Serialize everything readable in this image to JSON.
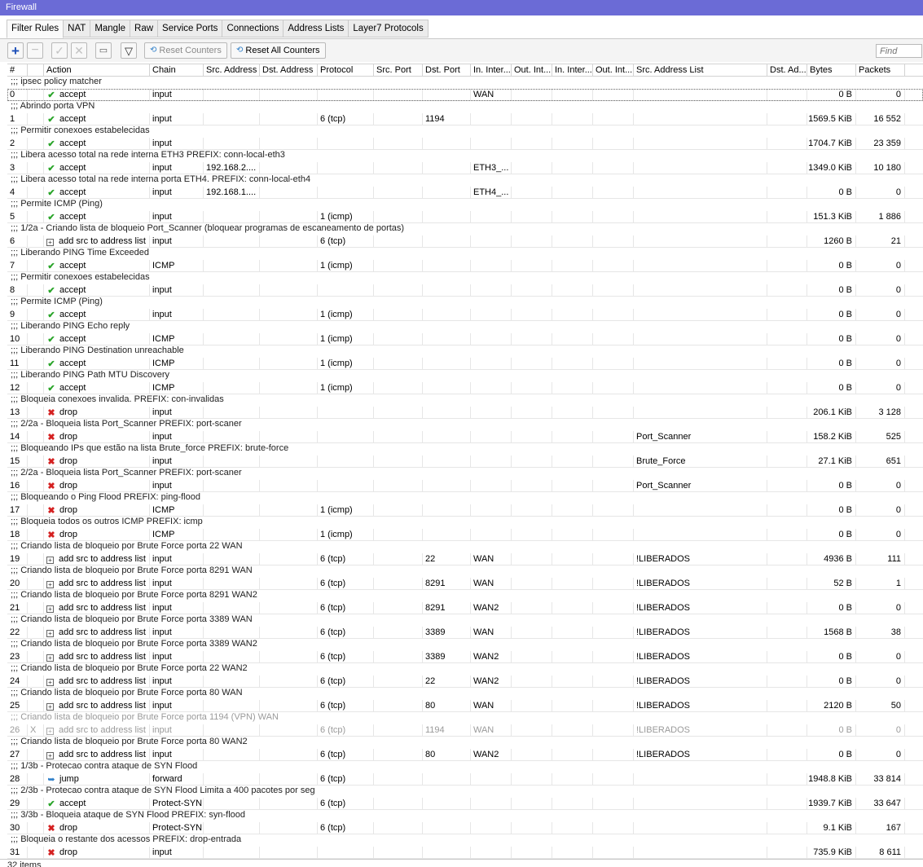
{
  "window": {
    "title": "Firewall"
  },
  "tabs": [
    "Filter Rules",
    "NAT",
    "Mangle",
    "Raw",
    "Service Ports",
    "Connections",
    "Address Lists",
    "Layer7 Protocols"
  ],
  "toolbar": {
    "reset_counters": "Reset Counters",
    "reset_all_counters": "Reset All Counters",
    "find_placeholder": "Find"
  },
  "columns": [
    "#",
    "",
    "Action",
    "Chain",
    "Src. Address",
    "Dst. Address",
    "Protocol",
    "Src. Port",
    "Dst. Port",
    "In. Inter...",
    "Out. Int...",
    "In. Inter...",
    "Out. Int...",
    "Src. Address List",
    "Dst. Ad...",
    "Bytes",
    "Packets"
  ],
  "rules": [
    {
      "comment": ";;; ipsec policy matcher",
      "num": "0",
      "action": "accept",
      "chain": "input",
      "src": "",
      "proto": "",
      "dport": "",
      "in": "WAN",
      "srclist": "",
      "bytes": "0 B",
      "packets": "0"
    },
    {
      "comment": ";;; Abrindo porta VPN",
      "num": "1",
      "action": "accept",
      "chain": "input",
      "src": "",
      "proto": "6 (tcp)",
      "dport": "1194",
      "in": "",
      "srclist": "",
      "bytes": "1569.5 KiB",
      "packets": "16 552"
    },
    {
      "comment": ";;; Permitir conexoes estabelecidas",
      "num": "2",
      "action": "accept",
      "chain": "input",
      "src": "",
      "proto": "",
      "dport": "",
      "in": "",
      "srclist": "",
      "bytes": "1704.7 KiB",
      "packets": "23 359"
    },
    {
      "comment": ";;; Libera acesso total na rede interna ETH3 PREFIX: conn-local-eth3",
      "num": "3",
      "action": "accept",
      "chain": "input",
      "src": "192.168.2....",
      "proto": "",
      "dport": "",
      "in": "ETH3_...",
      "srclist": "",
      "bytes": "1349.0 KiB",
      "packets": "10 180"
    },
    {
      "comment": ";;; Libera acesso total na rede interna porta ETH4. PREFIX: conn-local-eth4",
      "num": "4",
      "action": "accept",
      "chain": "input",
      "src": "192.168.1....",
      "proto": "",
      "dport": "",
      "in": "ETH4_...",
      "srclist": "",
      "bytes": "0 B",
      "packets": "0"
    },
    {
      "comment": ";;; Permite ICMP (Ping)",
      "num": "5",
      "action": "accept",
      "chain": "input",
      "src": "",
      "proto": "1 (icmp)",
      "dport": "",
      "in": "",
      "srclist": "",
      "bytes": "151.3 KiB",
      "packets": "1 886"
    },
    {
      "comment": ";;; 1/2a - Criando lista de bloqueio Port_Scanner (bloquear programas de escaneamento de portas)",
      "num": "6",
      "action": "add src to address list",
      "chain": "input",
      "src": "",
      "proto": "6 (tcp)",
      "dport": "",
      "in": "",
      "srclist": "",
      "bytes": "1260 B",
      "packets": "21"
    },
    {
      "comment": ";;; Liberando PING Time Exceeded",
      "num": "7",
      "action": "accept",
      "chain": "ICMP",
      "src": "",
      "proto": "1 (icmp)",
      "dport": "",
      "in": "",
      "srclist": "",
      "bytes": "0 B",
      "packets": "0"
    },
    {
      "comment": ";;; Permitir conexoes estabelecidas",
      "num": "8",
      "action": "accept",
      "chain": "input",
      "src": "",
      "proto": "",
      "dport": "",
      "in": "",
      "srclist": "",
      "bytes": "0 B",
      "packets": "0"
    },
    {
      "comment": ";;; Permite ICMP (Ping)",
      "num": "9",
      "action": "accept",
      "chain": "input",
      "src": "",
      "proto": "1 (icmp)",
      "dport": "",
      "in": "",
      "srclist": "",
      "bytes": "0 B",
      "packets": "0"
    },
    {
      "comment": ";;; Liberando PING Echo reply",
      "num": "10",
      "action": "accept",
      "chain": "ICMP",
      "src": "",
      "proto": "1 (icmp)",
      "dport": "",
      "in": "",
      "srclist": "",
      "bytes": "0 B",
      "packets": "0"
    },
    {
      "comment": ";;; Liberando PING Destination unreachable",
      "num": "11",
      "action": "accept",
      "chain": "ICMP",
      "src": "",
      "proto": "1 (icmp)",
      "dport": "",
      "in": "",
      "srclist": "",
      "bytes": "0 B",
      "packets": "0"
    },
    {
      "comment": ";;; Liberando PING Path MTU Discovery",
      "num": "12",
      "action": "accept",
      "chain": "ICMP",
      "src": "",
      "proto": "1 (icmp)",
      "dport": "",
      "in": "",
      "srclist": "",
      "bytes": "0 B",
      "packets": "0"
    },
    {
      "comment": ";;; Bloqueia conexoes invalida. PREFIX: con-invalidas",
      "num": "13",
      "action": "drop",
      "chain": "input",
      "src": "",
      "proto": "",
      "dport": "",
      "in": "",
      "srclist": "",
      "bytes": "206.1 KiB",
      "packets": "3 128"
    },
    {
      "comment": ";;; 2/2a - Bloqueia lista Port_Scanner PREFIX: port-scaner",
      "num": "14",
      "action": "drop",
      "chain": "input",
      "src": "",
      "proto": "",
      "dport": "",
      "in": "",
      "srclist": "Port_Scanner",
      "bytes": "158.2 KiB",
      "packets": "525"
    },
    {
      "comment": ";;; Bloqueando IPs que estão na lista Brute_force PREFIX: brute-force",
      "num": "15",
      "action": "drop",
      "chain": "input",
      "src": "",
      "proto": "",
      "dport": "",
      "in": "",
      "srclist": "Brute_Force",
      "bytes": "27.1 KiB",
      "packets": "651"
    },
    {
      "comment": ";;; 2/2a - Bloqueia lista Port_Scanner PREFIX: port-scaner",
      "num": "16",
      "action": "drop",
      "chain": "input",
      "src": "",
      "proto": "",
      "dport": "",
      "in": "",
      "srclist": "Port_Scanner",
      "bytes": "0 B",
      "packets": "0"
    },
    {
      "comment": ";;; Bloqueando o Ping Flood PREFIX: ping-flood",
      "num": "17",
      "action": "drop",
      "chain": "ICMP",
      "src": "",
      "proto": "1 (icmp)",
      "dport": "",
      "in": "",
      "srclist": "",
      "bytes": "0 B",
      "packets": "0"
    },
    {
      "comment": ";;; Bloqueia todos os outros ICMP PREFIX: icmp",
      "num": "18",
      "action": "drop",
      "chain": "ICMP",
      "src": "",
      "proto": "1 (icmp)",
      "dport": "",
      "in": "",
      "srclist": "",
      "bytes": "0 B",
      "packets": "0"
    },
    {
      "comment": ";;; Criando lista de bloqueio por Brute Force porta 22 WAN",
      "num": "19",
      "action": "add src to address list",
      "chain": "input",
      "src": "",
      "proto": "6 (tcp)",
      "dport": "22",
      "in": "WAN",
      "srclist": "!LIBERADOS",
      "bytes": "4936 B",
      "packets": "111"
    },
    {
      "comment": ";;; Criando lista de bloqueio por Brute Force porta 8291 WAN",
      "num": "20",
      "action": "add src to address list",
      "chain": "input",
      "src": "",
      "proto": "6 (tcp)",
      "dport": "8291",
      "in": "WAN",
      "srclist": "!LIBERADOS",
      "bytes": "52 B",
      "packets": "1"
    },
    {
      "comment": ";;; Criando lista de bloqueio por Brute Force porta 8291 WAN2",
      "num": "21",
      "action": "add src to address list",
      "chain": "input",
      "src": "",
      "proto": "6 (tcp)",
      "dport": "8291",
      "in": "WAN2",
      "srclist": "!LIBERADOS",
      "bytes": "0 B",
      "packets": "0"
    },
    {
      "comment": ";;; Criando lista de bloqueio por Brute Force porta 3389 WAN",
      "num": "22",
      "action": "add src to address list",
      "chain": "input",
      "src": "",
      "proto": "6 (tcp)",
      "dport": "3389",
      "in": "WAN",
      "srclist": "!LIBERADOS",
      "bytes": "1568 B",
      "packets": "38"
    },
    {
      "comment": ";;; Criando lista de bloqueio por Brute Force porta 3389 WAN2",
      "num": "23",
      "action": "add src to address list",
      "chain": "input",
      "src": "",
      "proto": "6 (tcp)",
      "dport": "3389",
      "in": "WAN2",
      "srclist": "!LIBERADOS",
      "bytes": "0 B",
      "packets": "0"
    },
    {
      "comment": ";;; Criando lista de bloqueio por Brute Force porta 22 WAN2",
      "num": "24",
      "action": "add src to address list",
      "chain": "input",
      "src": "",
      "proto": "6 (tcp)",
      "dport": "22",
      "in": "WAN2",
      "srclist": "!LIBERADOS",
      "bytes": "0 B",
      "packets": "0"
    },
    {
      "comment": ";;; Criando lista de bloqueio por Brute Force porta 80 WAN",
      "num": "25",
      "action": "add src to address list",
      "chain": "input",
      "src": "",
      "proto": "6 (tcp)",
      "dport": "80",
      "in": "WAN",
      "srclist": "!LIBERADOS",
      "bytes": "2120 B",
      "packets": "50"
    },
    {
      "comment": ";;; Criando lista de bloqueio por Brute Force porta 1194 (VPN) WAN",
      "num": "26",
      "flag": "X",
      "disabled": true,
      "action": "add src to address list",
      "chain": "input",
      "src": "",
      "proto": "6 (tcp)",
      "dport": "1194",
      "in": "WAN",
      "srclist": "!LIBERADOS",
      "bytes": "0 B",
      "packets": "0"
    },
    {
      "comment": ";;; Criando lista de bloqueio por Brute Force porta 80 WAN2",
      "num": "27",
      "action": "add src to address list",
      "chain": "input",
      "src": "",
      "proto": "6 (tcp)",
      "dport": "80",
      "in": "WAN2",
      "srclist": "!LIBERADOS",
      "bytes": "0 B",
      "packets": "0"
    },
    {
      "comment": ";;; 1/3b - Protecao contra ataque de SYN Flood",
      "num": "28",
      "action": "jump",
      "chain": "forward",
      "src": "",
      "proto": "6 (tcp)",
      "dport": "",
      "in": "",
      "srclist": "",
      "bytes": "1948.8 KiB",
      "packets": "33 814"
    },
    {
      "comment": ";;; 2/3b - Protecao contra ataque de SYN Flood Limita a 400 pacotes por seg",
      "num": "29",
      "action": "accept",
      "chain": "Protect-SYN",
      "src": "",
      "proto": "6 (tcp)",
      "dport": "",
      "in": "",
      "srclist": "",
      "bytes": "1939.7 KiB",
      "packets": "33 647"
    },
    {
      "comment": ";;; 3/3b - Bloqueia ataque de SYN Flood PREFIX: syn-flood",
      "num": "30",
      "action": "drop",
      "chain": "Protect-SYN",
      "src": "",
      "proto": "6 (tcp)",
      "dport": "",
      "in": "",
      "srclist": "",
      "bytes": "9.1 KiB",
      "packets": "167"
    },
    {
      "comment": ";;; Bloqueia o restante dos acessos PREFIX: drop-entrada",
      "num": "31",
      "action": "drop",
      "chain": "input",
      "src": "",
      "proto": "",
      "dport": "",
      "in": "",
      "srclist": "",
      "bytes": "735.9 KiB",
      "packets": "8 611"
    }
  ],
  "status": {
    "items": "32 items"
  }
}
